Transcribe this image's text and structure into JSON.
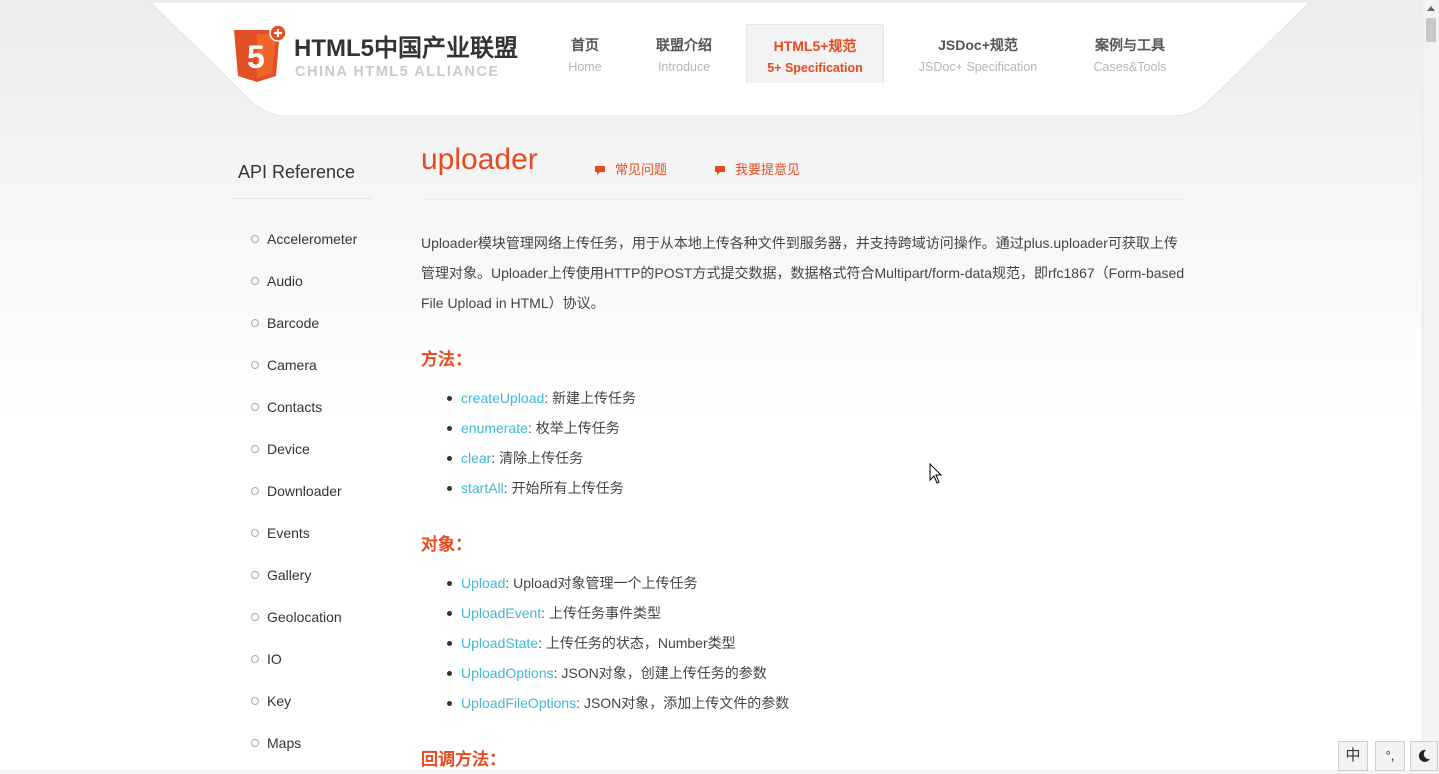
{
  "header": {
    "logo": {
      "title": "HTML5中国产业联盟",
      "subtitle": "CHINA HTML5 ALLIANCE",
      "badge_text": "5"
    },
    "nav": [
      {
        "zh": "首页",
        "en": "Home"
      },
      {
        "zh": "联盟介绍",
        "en": "Introduce"
      },
      {
        "zh": "HTML5+规范",
        "en": "5+ Specification",
        "active": true
      },
      {
        "zh": "JSDoc+规范",
        "en": "JSDoc+ Specification"
      },
      {
        "zh": "案例与工具",
        "en": "Cases&Tools"
      }
    ]
  },
  "sidebar": {
    "title": "API Reference",
    "items": [
      "Accelerometer",
      "Audio",
      "Barcode",
      "Camera",
      "Contacts",
      "Device",
      "Downloader",
      "Events",
      "Gallery",
      "Geolocation",
      "IO",
      "Key",
      "Maps"
    ]
  },
  "main": {
    "title": "uploader",
    "faq_link": "常见问题",
    "feedback_link": "我要提意见",
    "intro": "Uploader模块管理网络上传任务，用于从本地上传各种文件到服务器，并支持跨域访问操作。通过plus.uploader可获取上传管理对象。Uploader上传使用HTTP的POST方式提交数据，数据格式符合Multipart/form-data规范，即rfc1867（Form-based File Upload in HTML）协议。",
    "methods_heading": "方法：",
    "methods": [
      {
        "name": "createUpload",
        "desc": ": 新建上传任务"
      },
      {
        "name": "enumerate",
        "desc": ": 枚举上传任务"
      },
      {
        "name": "clear",
        "desc": ": 清除上传任务"
      },
      {
        "name": "startAll",
        "desc": ": 开始所有上传任务"
      }
    ],
    "objects_heading": "对象：",
    "objects": [
      {
        "name": "Upload",
        "desc": ": Upload对象管理一个上传任务"
      },
      {
        "name": "UploadEvent",
        "desc": ": 上传任务事件类型"
      },
      {
        "name": "UploadState",
        "desc": ": 上传任务的状态，Number类型"
      },
      {
        "name": "UploadOptions",
        "desc": ": JSON对象，创建上传任务的参数"
      },
      {
        "name": "UploadFileOptions",
        "desc": ": JSON对象，添加上传文件的参数"
      }
    ],
    "callbacks_heading": "回调方法："
  },
  "ime_toolbar": {
    "lang": "中",
    "punct": "°,",
    "mode_icon": "moon-icon"
  },
  "colors": {
    "accent": "#e8491d",
    "link": "#40b8d6",
    "logo_orange": "#e34f26"
  }
}
